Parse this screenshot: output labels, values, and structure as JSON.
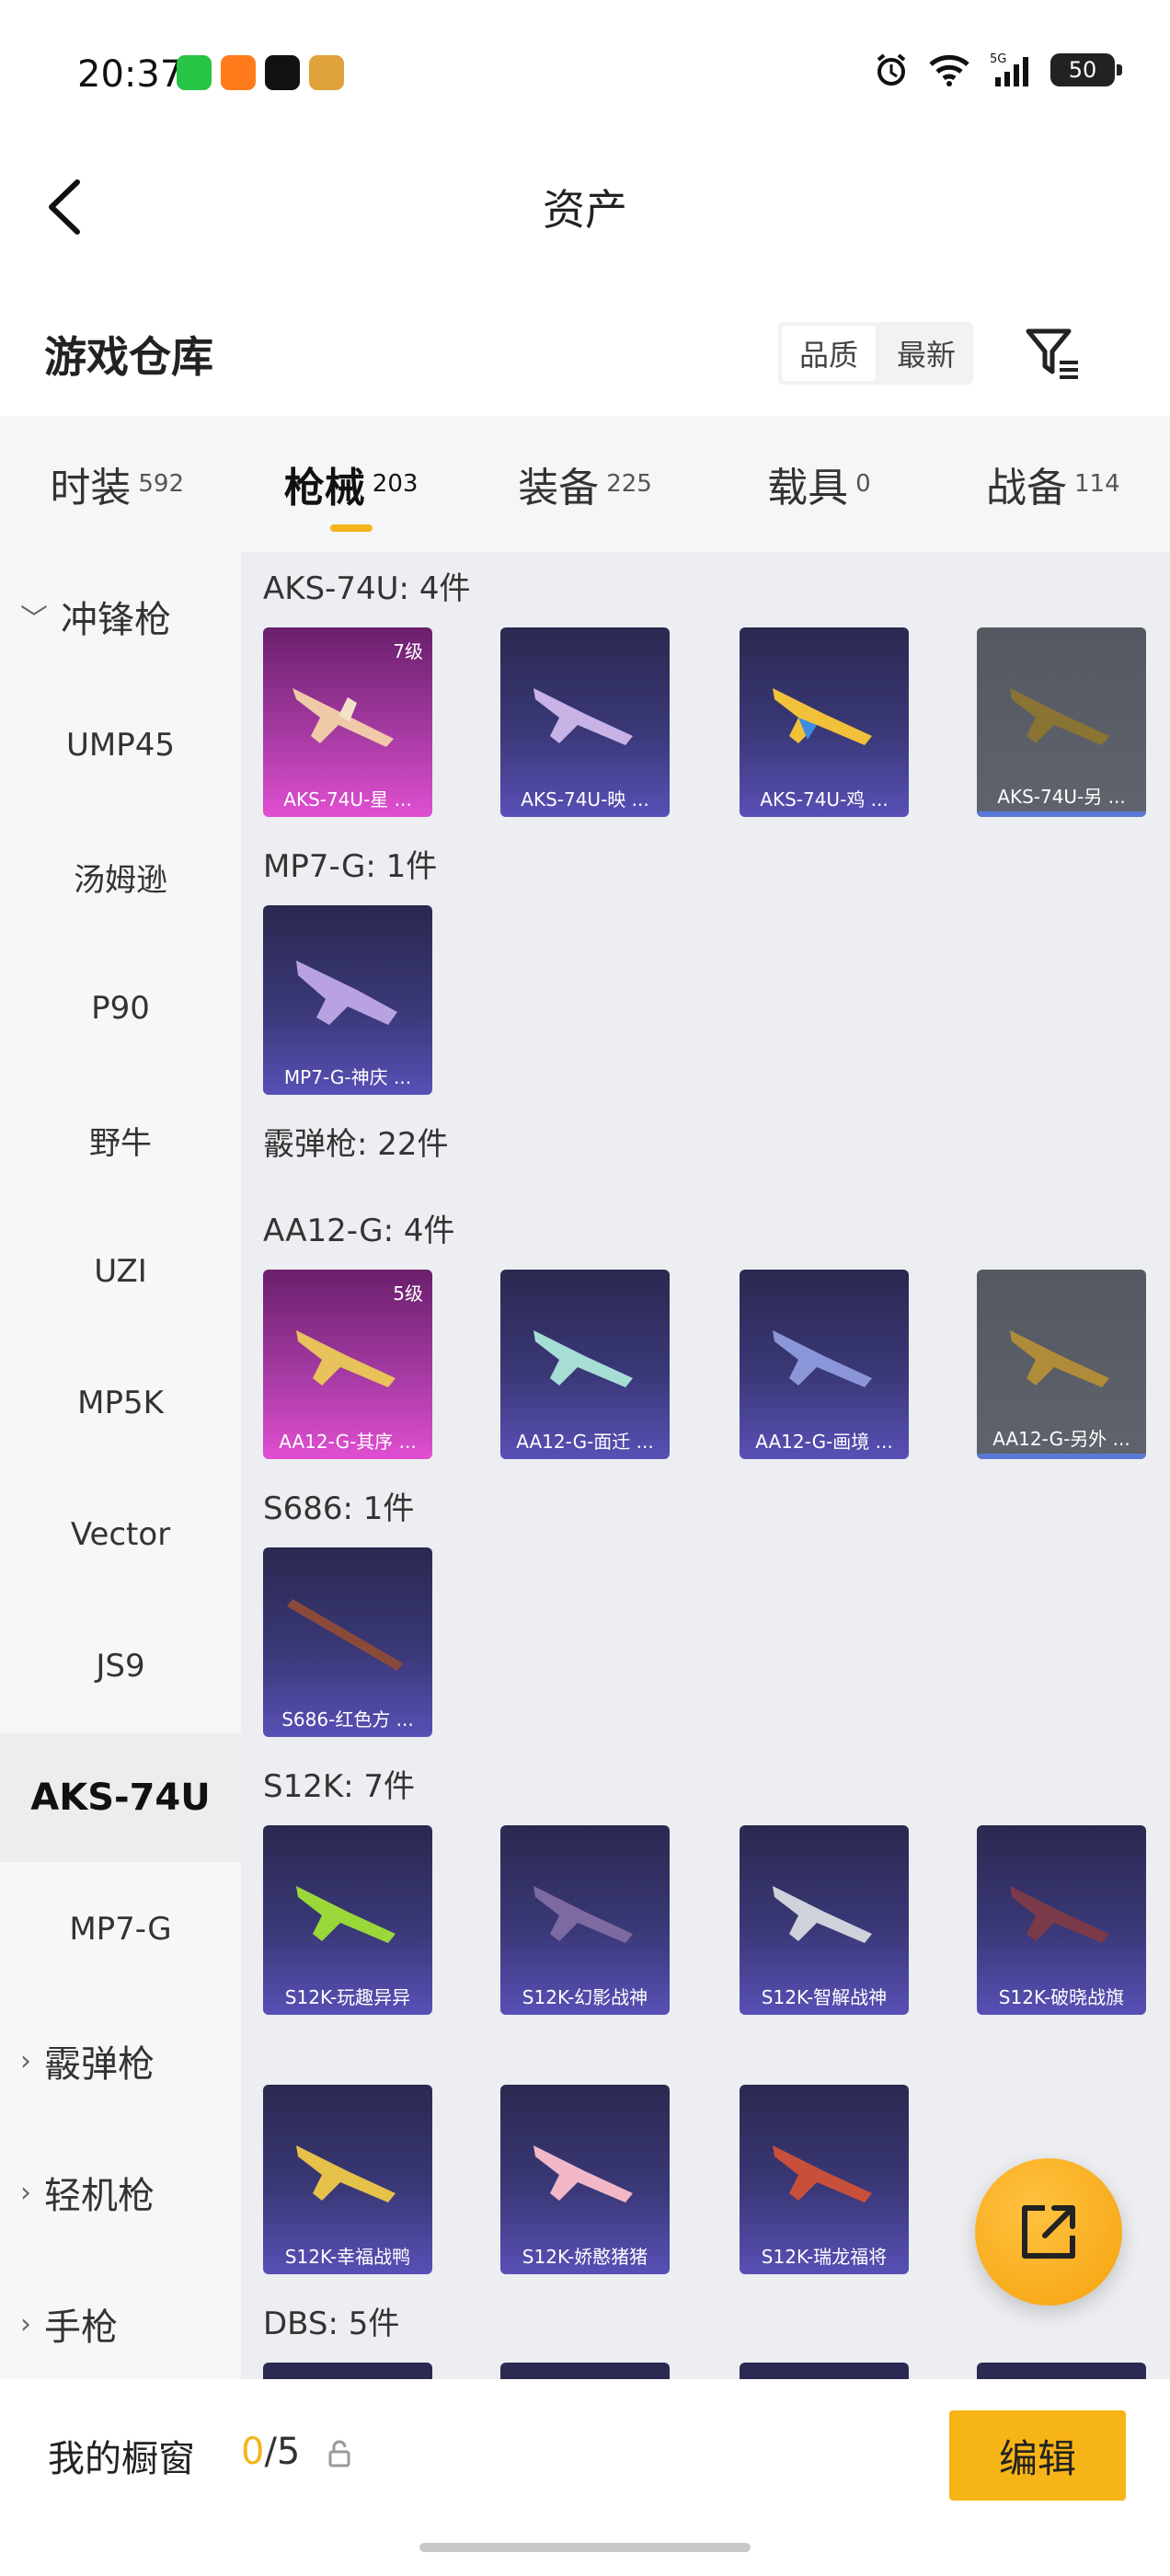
{
  "status_bar": {
    "time": "20:37",
    "battery": "50",
    "network": "5G"
  },
  "nav": {
    "title": "资产"
  },
  "warehouse": {
    "title": "游戏仓库",
    "sort_options": [
      {
        "label": "品质"
      },
      {
        "label": "最新"
      }
    ]
  },
  "tabs": [
    {
      "label": "时装",
      "count": "592"
    },
    {
      "label": "枪械",
      "count": "203"
    },
    {
      "label": "装备",
      "count": "225"
    },
    {
      "label": "载具",
      "count": "0"
    },
    {
      "label": "战备",
      "count": "114"
    }
  ],
  "sidebar": {
    "group_open": "冲锋枪",
    "items": [
      {
        "label": "UMP45"
      },
      {
        "label": "汤姆逊"
      },
      {
        "label": "P90"
      },
      {
        "label": "野牛"
      },
      {
        "label": "UZI"
      },
      {
        "label": "MP5K"
      },
      {
        "label": "Vector"
      },
      {
        "label": "JS9"
      },
      {
        "label": "AKS-74U"
      },
      {
        "label": "MP7-G"
      }
    ],
    "groups": [
      {
        "label": "霰弹枪"
      },
      {
        "label": "轻机枪"
      },
      {
        "label": "手枪"
      }
    ]
  },
  "sections": {
    "aks": {
      "title": "AKS-74U: 4件",
      "cards": [
        {
          "name": "AKS-74U-星 ...",
          "level": "7级"
        },
        {
          "name": "AKS-74U-映 ..."
        },
        {
          "name": "AKS-74U-鸡 ..."
        },
        {
          "name": "AKS-74U-另 ..."
        }
      ]
    },
    "mp7": {
      "title": "MP7-G: 1件",
      "cards": [
        {
          "name": "MP7-G-神庆 ..."
        }
      ]
    },
    "shotgun_header": "霰弹枪: 22件",
    "aa12": {
      "title": "AA12-G: 4件",
      "cards": [
        {
          "name": "AA12-G-其序 ...",
          "level": "5级"
        },
        {
          "name": "AA12-G-面迁 ..."
        },
        {
          "name": "AA12-G-画境 ..."
        },
        {
          "name": "AA12-G-另外 ..."
        }
      ]
    },
    "s686": {
      "title": "S686: 1件",
      "cards": [
        {
          "name": "S686-红色方 ..."
        }
      ]
    },
    "s12k": {
      "title": "S12K: 7件",
      "cards": [
        {
          "name": "S12K-玩趣异异"
        },
        {
          "name": "S12K-幻影战神"
        },
        {
          "name": "S12K-智解战神"
        },
        {
          "name": "S12K-破晓战旗"
        },
        {
          "name": "S12K-幸福战鸭"
        },
        {
          "name": "S12K-娇憨猪猪"
        },
        {
          "name": "S12K-瑞龙福将"
        }
      ]
    },
    "dbs": {
      "title": "DBS: 5件"
    }
  },
  "bottom": {
    "my_window": "我的橱窗",
    "count_current": "0",
    "count_total": "/5",
    "edit_label": "编辑"
  },
  "colors": {
    "accent": "#f5b41c",
    "card_purple": "#5850b6",
    "card_pink": "#e04fd1",
    "card_grey": "#5f636c"
  }
}
